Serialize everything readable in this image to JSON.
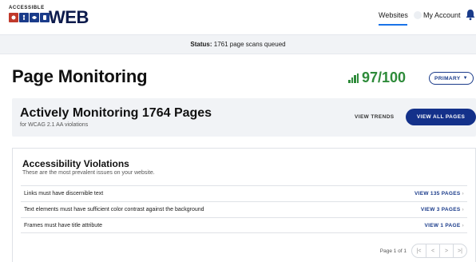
{
  "header": {
    "logo_small": "ACCESSIBLE",
    "logo_big": "WEB",
    "nav": {
      "websites": "Websites",
      "account": "My Account"
    },
    "icons": [
      "logo-tile-1-icon",
      "logo-tile-2-icon",
      "logo-tile-3-icon",
      "logo-tile-4-icon",
      "user-dot-icon",
      "bell-icon"
    ],
    "colors": {
      "tiles": [
        "#c0392b",
        "#1a3b8a",
        "#1a3b8a",
        "#1a3b8a"
      ],
      "active_underline": "#1a73e8"
    }
  },
  "status": {
    "label": "Status:",
    "text": "1761 page scans queued"
  },
  "page": {
    "title": "Page Monitoring",
    "score": "97/100",
    "score_color": "#2e8b3a",
    "primary_button": "PRIMARY"
  },
  "monitoring": {
    "title": "Actively Monitoring 1764 Pages",
    "subtitle": "for WCAG 2.1 AA violations",
    "trends_link": "VIEW TRENDS",
    "view_all_button": "VIEW ALL PAGES",
    "button_color": "#14318a"
  },
  "violations": {
    "title": "Accessibility Violations",
    "subtitle": "These are the most prevalent issues on your website.",
    "rows": [
      {
        "name": "Links must have discernible text",
        "link": "VIEW 135 PAGES"
      },
      {
        "name": "Text elements must have sufficient color contrast against the background",
        "link": "VIEW 3 PAGES"
      },
      {
        "name": "Frames must have title attribute",
        "link": "VIEW 1 PAGE"
      }
    ],
    "pagination": {
      "text": "Page 1 of 1",
      "buttons": [
        "|<",
        "<",
        ">",
        ">|"
      ]
    }
  }
}
